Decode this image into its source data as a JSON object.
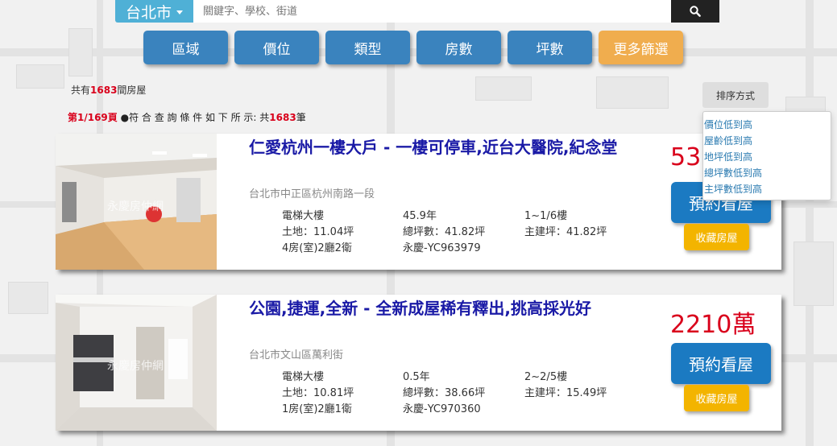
{
  "search": {
    "city": "台北市",
    "placeholder": "關鍵字、學校、街道"
  },
  "filters": [
    "區域",
    "價位",
    "類型",
    "房數",
    "坪數",
    "更多篩選"
  ],
  "summary": {
    "total_prefix": "共有",
    "total_count": "1683",
    "total_suffix": "間房屋",
    "page_label": "第1/169頁",
    "condition_text": " ●符 合 查 詢 條 件 如 下 所 示: 共",
    "condition_count": "1683",
    "condition_suffix": "筆"
  },
  "sort": {
    "button_label": "排序方式",
    "options": [
      "價位低到高",
      "屋齡低到高",
      "地坪低到高",
      "總坪數低到高",
      "主坪數低到高"
    ]
  },
  "listings": [
    {
      "title": "仁愛杭州一樓大戶 - 一樓可停車,近台大醫院,紀念堂",
      "address": "台北市中正區杭州南路一段",
      "price": "538",
      "watermark": "永慶房仲網",
      "specs": [
        "電梯大樓",
        "45.9年",
        "1~1/6樓",
        "土地：11.04坪",
        "總坪數：41.82坪",
        "主建坪：41.82坪",
        "4房(室)2廳2衛",
        "永慶-YC963979",
        ""
      ],
      "book_label": "預約看屋",
      "fav_label": "收藏房屋"
    },
    {
      "title": "公園,捷運,全新 - 全新成屋稀有釋出,挑高採光好",
      "address": "台北市文山區萬利街",
      "price": "2210萬",
      "watermark": "永慶房仲網",
      "specs": [
        "電梯大樓",
        "0.5年",
        "2~2/5樓",
        "土地：10.81坪",
        "總坪數：38.66坪",
        "主建坪：15.49坪",
        "1房(室)2廳1衛",
        "永慶-YC970360",
        ""
      ],
      "book_label": "預約看屋",
      "fav_label": "收藏房屋"
    }
  ],
  "colors": {
    "city_button": "#4fb0d6",
    "filter_button": "#3a83be",
    "more_filter_button": "#f0ad4e",
    "price": "#d9001b",
    "title": "#1a1aa6",
    "book_button": "#1b7ac2",
    "fav_button": "#f3b400"
  }
}
